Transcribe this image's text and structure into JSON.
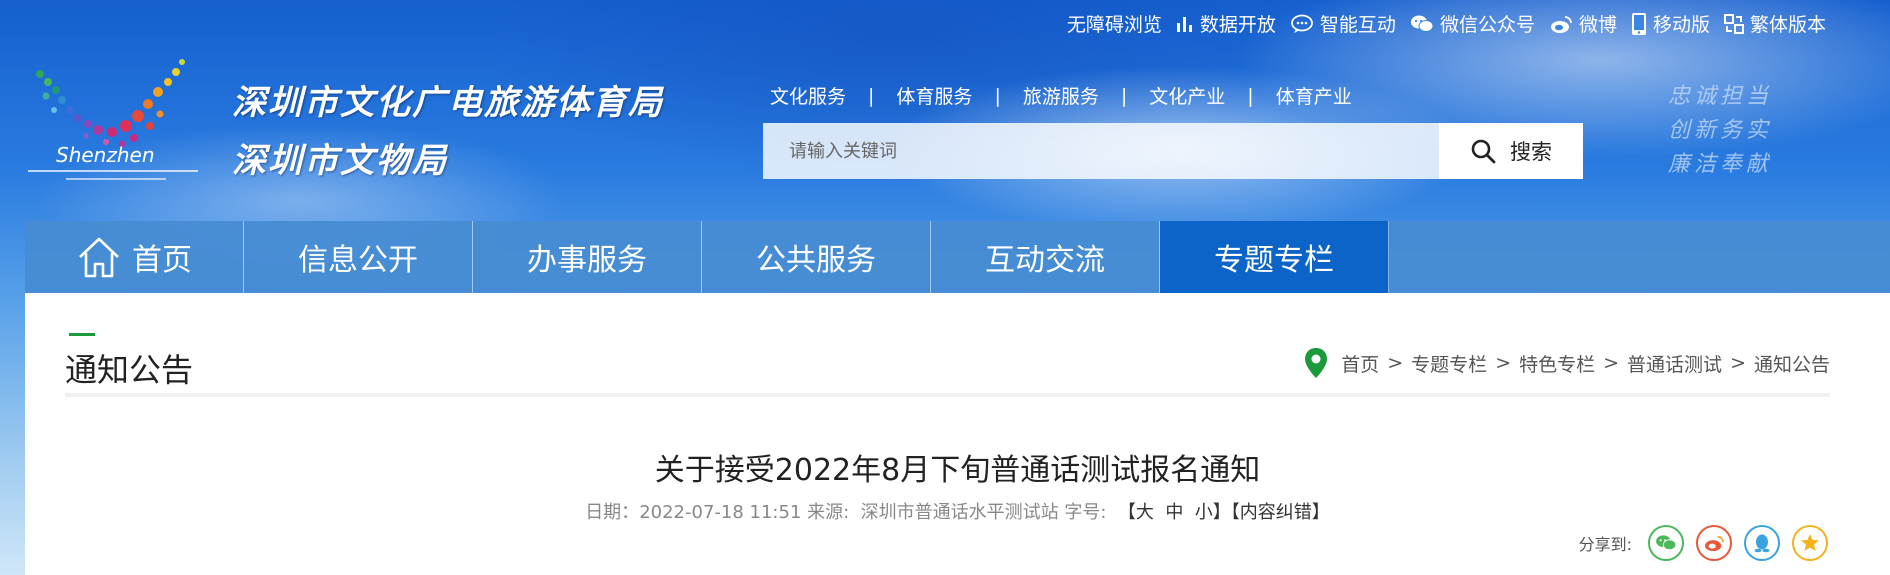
{
  "util_links": [
    {
      "label": "无障碍浏览",
      "icon": "none"
    },
    {
      "label": "数据开放",
      "icon": "bar-chart-icon"
    },
    {
      "label": "智能互动",
      "icon": "chat-icon"
    },
    {
      "label": "微信公众号",
      "icon": "wechat-icon"
    },
    {
      "label": "微博",
      "icon": "weibo-icon"
    },
    {
      "label": "移动版",
      "icon": "mobile-icon"
    },
    {
      "label": "繁体版本",
      "icon": "traditional-icon"
    }
  ],
  "logo": {
    "text": "Shenzhen"
  },
  "site": {
    "title_line1": "深圳市文化广电旅游体育局",
    "title_line2": "深圳市文物局"
  },
  "quick_links": [
    "文化服务",
    "体育服务",
    "旅游服务",
    "文化产业",
    "体育产业"
  ],
  "quick_sep": "|",
  "search": {
    "placeholder": "请输入关键词",
    "button": "搜索"
  },
  "slogan": [
    "忠诚担当",
    "创新务实",
    "廉洁奉献"
  ],
  "nav": [
    {
      "label": "首页",
      "icon": "home-icon"
    },
    {
      "label": "信息公开"
    },
    {
      "label": "办事服务"
    },
    {
      "label": "公共服务"
    },
    {
      "label": "互动交流"
    },
    {
      "label": "专题专栏",
      "active": true
    }
  ],
  "section": {
    "title": "通知公告"
  },
  "breadcrumb": [
    "首页",
    "专题专栏",
    "特色专栏",
    "普通话测试",
    "通知公告"
  ],
  "breadcrumb_sep": ">",
  "article": {
    "title": "关于接受2022年8月下旬普通话测试报名通知",
    "date_label": "日期：",
    "date": "2022-07-18 11:51",
    "source_label": " 来源:",
    "source": "  深圳市普通话水平测试站",
    "font_label": " 字号:",
    "size_large": "  【大",
    "size_medium": "  中",
    "size_small": "  小】",
    "correction": "【内容纠错】"
  },
  "share": {
    "label": "分享到:",
    "icons": [
      "wechat-share-icon",
      "weibo-share-icon",
      "qq-share-icon",
      "favorite-share-icon"
    ]
  },
  "colors": {
    "nav_bg": "#468cd2",
    "nav_active": "#0c64c8",
    "accent_green": "#1a9a3a",
    "location_pin": "#1a9a3a"
  }
}
